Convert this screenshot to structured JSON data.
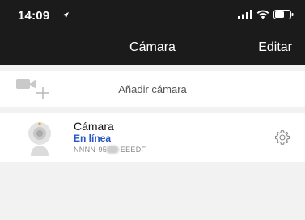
{
  "status_bar": {
    "time": "14:09"
  },
  "nav": {
    "title": "Cámara",
    "edit_label": "Editar"
  },
  "add_camera": {
    "label": "Añadir cámara",
    "icon": "add-camera-icon"
  },
  "devices": [
    {
      "name": "Cámara",
      "status": "En línea",
      "id": "NNNN-95 99-EEEDF"
    }
  ],
  "colors": {
    "top_bar": "#1b1b1b",
    "status_online": "#2756c5",
    "background": "#f2f2f2"
  }
}
